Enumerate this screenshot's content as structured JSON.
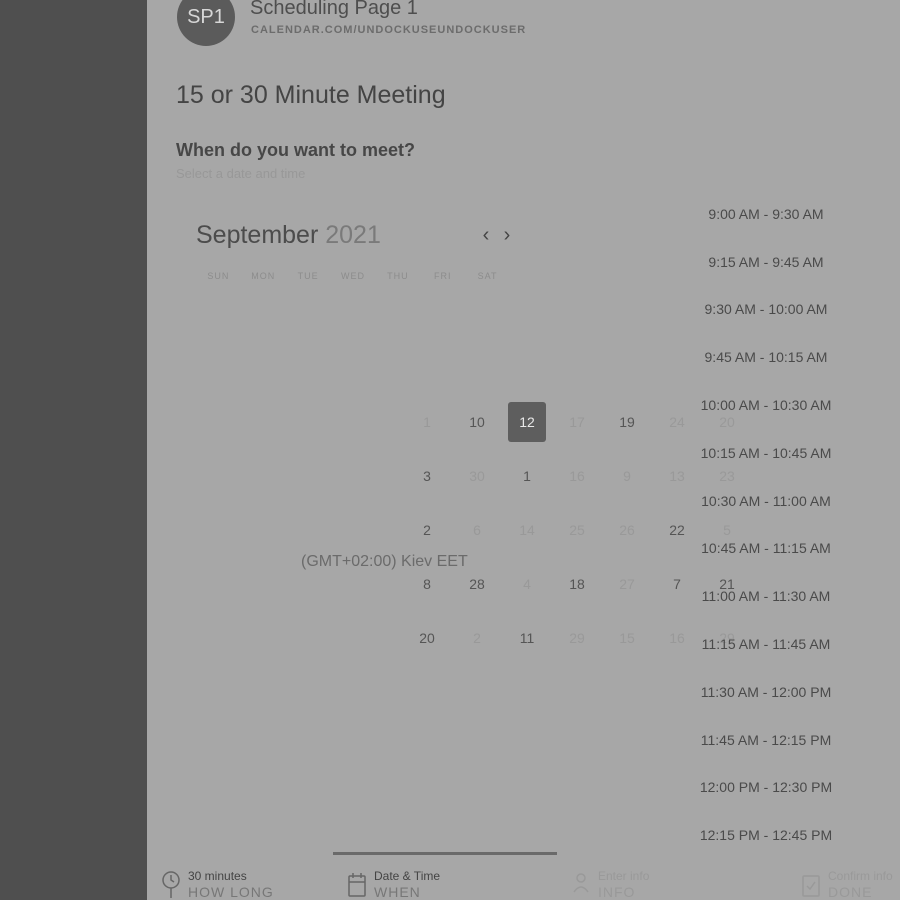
{
  "header": {
    "avatar_initials": "SP1",
    "page_name": "Scheduling Page 1",
    "page_url": "CALENDAR.COM/UNDOCKUSEUNDOCKUSER"
  },
  "title": "15 or 30 Minute Meeting",
  "question": "When do you want to meet?",
  "hint": "Select a date and time",
  "calendar": {
    "month": "September",
    "year": "2021",
    "weekdays": [
      "SUN",
      "MON",
      "TUE",
      "WED",
      "THU",
      "FRI",
      "SAT"
    ],
    "selected_day": "12",
    "days": [
      {
        "label": "1",
        "faint": true
      },
      {
        "label": "10",
        "faint": false
      },
      {
        "label": "12",
        "faint": false,
        "selected": true
      },
      {
        "label": "17",
        "faint": true
      },
      {
        "label": "19",
        "faint": false
      },
      {
        "label": "24",
        "faint": true
      },
      {
        "label": "20",
        "faint": true
      },
      {
        "label": "3",
        "faint": false
      },
      {
        "label": "30",
        "faint": true
      },
      {
        "label": "1",
        "faint": false
      },
      {
        "label": "16",
        "faint": true
      },
      {
        "label": "9",
        "faint": true
      },
      {
        "label": "13",
        "faint": true
      },
      {
        "label": "23",
        "faint": true
      },
      {
        "label": "2",
        "faint": false
      },
      {
        "label": "6",
        "faint": true
      },
      {
        "label": "14",
        "faint": true
      },
      {
        "label": "25",
        "faint": true
      },
      {
        "label": "26",
        "faint": true
      },
      {
        "label": "22",
        "faint": false
      },
      {
        "label": "5",
        "faint": true
      },
      {
        "label": "8",
        "faint": false
      },
      {
        "label": "28",
        "faint": false
      },
      {
        "label": "4",
        "faint": true
      },
      {
        "label": "18",
        "faint": false
      },
      {
        "label": "27",
        "faint": true
      },
      {
        "label": "7",
        "faint": false
      },
      {
        "label": "21",
        "faint": false
      },
      {
        "label": "20",
        "faint": false
      },
      {
        "label": "2",
        "faint": true
      },
      {
        "label": "11",
        "faint": false
      },
      {
        "label": "29",
        "faint": true
      },
      {
        "label": "15",
        "faint": true
      },
      {
        "label": "16",
        "faint": true
      },
      {
        "label": "29",
        "faint": true
      }
    ]
  },
  "timezone": "(GMT+02:00) Kiev EET",
  "time_slots": [
    "9:00 AM - 9:30 AM",
    "9:15 AM - 9:45 AM",
    "9:30 AM - 10:00 AM",
    "9:45 AM - 10:15 AM",
    "10:00 AM - 10:30 AM",
    "10:15 AM - 10:45 AM",
    "10:30 AM - 11:00 AM",
    "10:45 AM - 11:15 AM",
    "11:00 AM - 11:30 AM",
    "11:15 AM - 11:45 AM",
    "11:30 AM - 12:00 PM",
    "11:45 AM - 12:15 PM",
    "12:00 PM - 12:30 PM",
    "12:15 PM - 12:45 PM"
  ],
  "steps": [
    {
      "label": "30 minutes",
      "sub": "HOW LONG",
      "icon": "clock-icon",
      "active": false,
      "dim": false
    },
    {
      "label": "Date & Time",
      "sub": "WHEN",
      "icon": "calendar-icon",
      "active": true,
      "dim": false
    },
    {
      "label": "Enter info",
      "sub": "INFO",
      "icon": "person-icon",
      "active": false,
      "dim": true
    },
    {
      "label": "Confirm info",
      "sub": "DONE",
      "icon": "check-icon",
      "active": false,
      "dim": true
    }
  ]
}
